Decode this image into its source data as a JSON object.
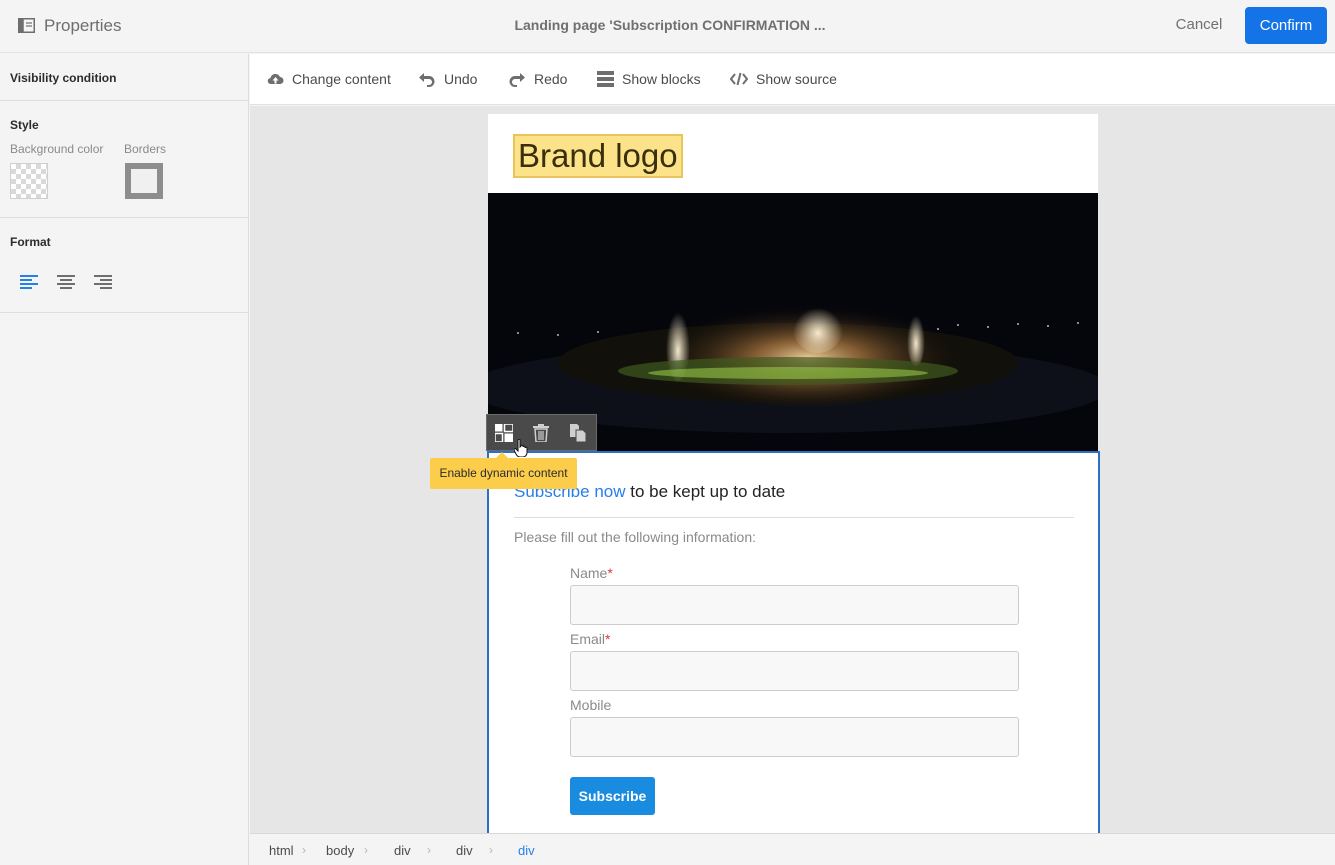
{
  "header": {
    "panel_title": "Properties",
    "document_title": "Landing page 'Subscription CONFIRMATION ...",
    "cancel_label": "Cancel",
    "confirm_label": "Confirm"
  },
  "sidebar": {
    "visibility_label": "Visibility condition",
    "style_label": "Style",
    "background_color_label": "Background color",
    "borders_label": "Borders",
    "format_label": "Format",
    "alignments": [
      "align-left",
      "align-center",
      "align-right"
    ],
    "active_alignment": "align-left"
  },
  "toolbar": {
    "change_content": "Change content",
    "undo": "Undo",
    "redo": "Redo",
    "show_blocks": "Show blocks",
    "show_source": "Show source"
  },
  "content": {
    "brand_logo": "Brand logo",
    "headline_highlight": "Subscribe now",
    "headline_rest": " to be kept up to date",
    "intro": "Please fill out the following information:",
    "fields": [
      {
        "label": "Name",
        "required": "*"
      },
      {
        "label": "Email",
        "required": "*"
      },
      {
        "label": "Mobile",
        "required": ""
      }
    ],
    "subscribe_label": "Subscribe"
  },
  "block_toolbar": {
    "icons": [
      "dynamic-content-icon",
      "trash-icon",
      "duplicate-icon"
    ],
    "tooltip": "Enable dynamic content"
  },
  "breadcrumb": [
    "html",
    "body",
    "div",
    "div",
    "div"
  ],
  "colors": {
    "accent": "#1473e6",
    "link": "#2680eb",
    "tooltip": "#fbcd4a",
    "logo_highlight": "#fce38a",
    "selection": "#2c6fc4"
  }
}
